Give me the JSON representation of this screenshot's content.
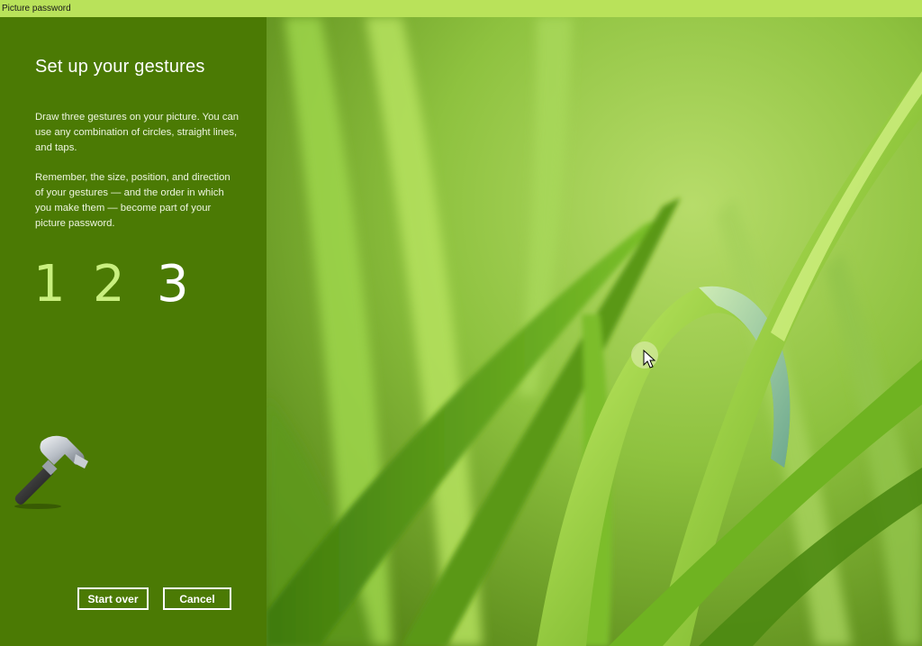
{
  "window": {
    "title": "Picture password"
  },
  "panel": {
    "heading": "Set up your gestures",
    "paragraph1": "Draw three gestures on your picture. You can use any combination of circles, straight lines, and taps.",
    "paragraph2": "Remember, the size, position, and direction of your gestures — and the order in which you make them — become part of your picture password.",
    "steps": [
      {
        "label": "1",
        "state": "done"
      },
      {
        "label": "2",
        "state": "done"
      },
      {
        "label": "3",
        "state": "current"
      }
    ],
    "buttons": {
      "start_over": "Start over",
      "cancel": "Cancel"
    },
    "icon": "hammer-icon"
  },
  "picture": {
    "subject": "grass-photo"
  },
  "colors": {
    "titlebar": "#b9e25a",
    "panel": "#4b7a04",
    "step_done": "#c9ef7f",
    "step_current": "#ffffff"
  }
}
